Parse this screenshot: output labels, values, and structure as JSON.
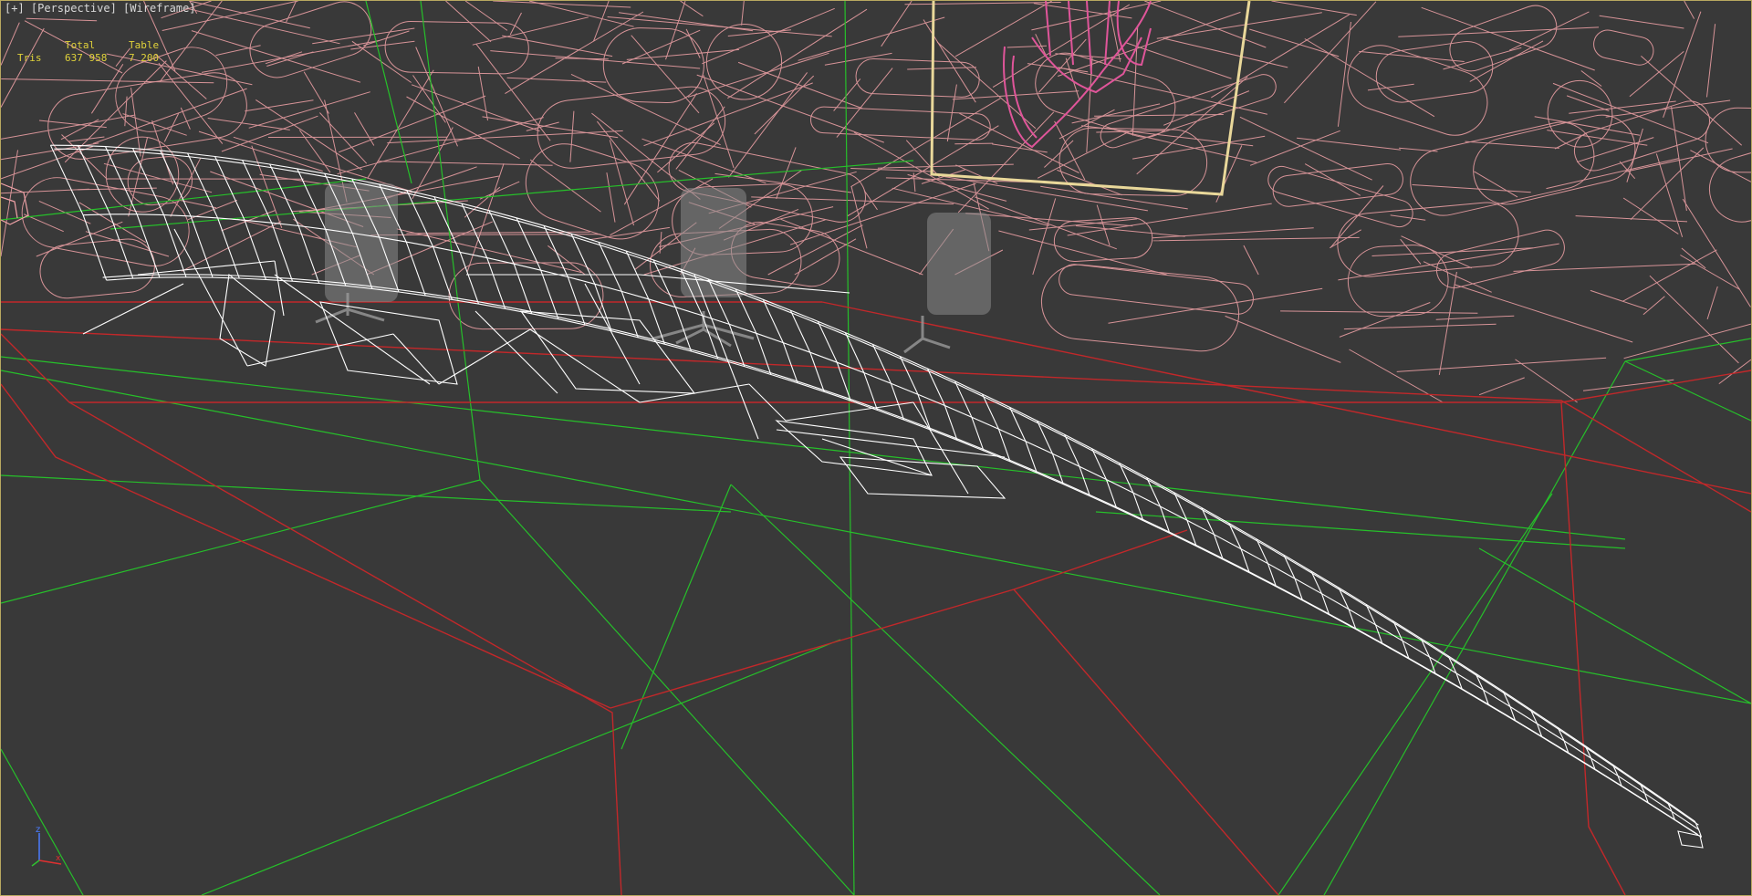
{
  "viewport": {
    "label": "[+] [Perspective] [Wireframe]",
    "background": "#393939"
  },
  "stats": {
    "headers": [
      "",
      "Total",
      "Table"
    ],
    "rows": [
      {
        "label": "Tris",
        "total": "637 958",
        "selection": "7 200"
      }
    ]
  },
  "colors": {
    "background_mesh": "#f2a3a8",
    "selected_mesh": "#ffffff",
    "highlight_mesh": "#e0559a",
    "floor_grid_green": "#26c02a",
    "floor_grid_red": "#c2282a",
    "frame_yellow": "#e9d89a",
    "chairs": "#8a8a8a"
  },
  "axis_gizmo": {
    "labels": [
      "z",
      "x"
    ],
    "icon": "axis-tripod-icon"
  }
}
